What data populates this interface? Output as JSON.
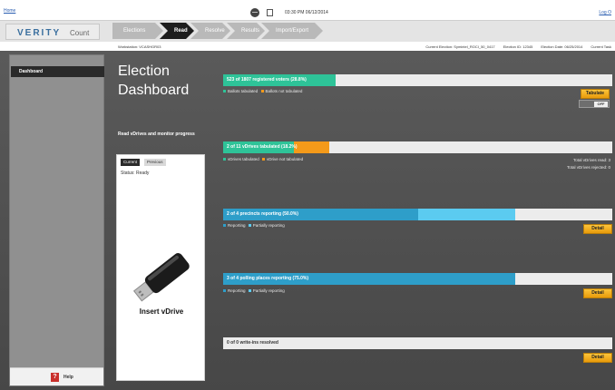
{
  "topbar": {
    "home": "Home",
    "datetime": "03:30 PM 06/12/2014",
    "logout": "Log O"
  },
  "brand": {
    "name": "VERITY",
    "product": "Count"
  },
  "tabs": [
    {
      "label": "Elections",
      "active": false
    },
    {
      "label": "Read",
      "active": true
    },
    {
      "label": "Resolve",
      "active": false
    },
    {
      "label": "Results",
      "active": false
    },
    {
      "label": "Import/Export",
      "active": false
    }
  ],
  "info": {
    "workstation": "Workstation: VCASHGR03",
    "current_election": "Current Election: Symintel_ROCI_50_0417",
    "election_id": "Election ID: 12345",
    "election_date": "Election Date: 06/25/2014",
    "current_task": "Current Task"
  },
  "sidebar": {
    "dashboard": "Dashboard",
    "help": "Help"
  },
  "page": {
    "title": "Election Dashboard"
  },
  "read_section": {
    "title": "Read vDrives and monitor progress",
    "tab_current": "Current",
    "tab_previous": "Previous",
    "status": "Status: Ready",
    "insert_label": "Insert vDrive"
  },
  "sections": {
    "voters": {
      "label": "523 of 1807 registered voters (28.8%)",
      "fraction": 0.288,
      "legend": [
        "Ballots tabulated",
        "Ballots not tabulated"
      ],
      "button": "Tabulate",
      "toggle": "OFF"
    },
    "vdrives": {
      "label": "2 of 11 vDrives tabulated (18.2%)",
      "fraction_tabulated": 0.182,
      "fraction_not_tabulated": 0.091,
      "legend": [
        "vDrives tabulated",
        "vDrive not tabulated"
      ],
      "stats_read": "Total vDrives read: 3",
      "stats_rejected": "Total vDrives rejected: 0"
    },
    "precincts": {
      "label": "2 of 4 precincts reporting (50.0%)",
      "fraction_reporting": 0.5,
      "fraction_partial": 0.25,
      "legend": [
        "Reporting",
        "Partially reporting"
      ],
      "button": "Detail"
    },
    "polling": {
      "label": "3 of 4 polling places reporting (75.0%)",
      "fraction_reporting": 0.75,
      "legend": [
        "Reporting",
        "Partially reporting"
      ],
      "button": "Detail"
    },
    "writeins": {
      "label": "0 of 0 write-ins resolved",
      "button": "Detail"
    }
  },
  "colors": {
    "green": "#2ec398",
    "orange": "#f49a1a",
    "blue_dark": "#2e9ec9",
    "blue_light": "#5bcbf0",
    "button": "#f3b021"
  }
}
